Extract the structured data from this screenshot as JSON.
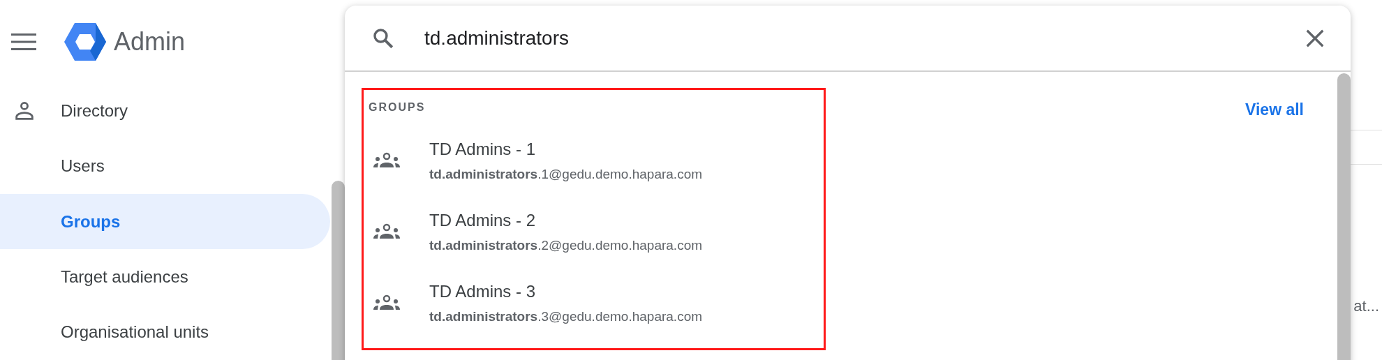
{
  "app": {
    "title": "Admin"
  },
  "sidebar": {
    "items": [
      {
        "label": "Directory",
        "kind": "section",
        "selected": false
      },
      {
        "label": "Users",
        "kind": "item",
        "selected": false
      },
      {
        "label": "Groups",
        "kind": "item",
        "selected": true
      },
      {
        "label": "Target audiences",
        "kind": "item",
        "selected": false
      },
      {
        "label": "Organisational units",
        "kind": "item",
        "selected": false
      }
    ]
  },
  "search": {
    "value": "td.administrators",
    "results": {
      "heading": "GROUPS",
      "view_all": "View all",
      "items": [
        {
          "name": "TD Admins - 1",
          "email": "**td.administrators**.1@gedu.demo.hapara.com"
        },
        {
          "name": "TD Admins - 2",
          "email": "**td.administrators**.2@gedu.demo.hapara.com"
        },
        {
          "name": "TD Admins - 3",
          "email": "**td.administrators**.3@gedu.demo.hapara.com"
        }
      ]
    }
  },
  "background": {
    "column_1": "at..."
  }
}
